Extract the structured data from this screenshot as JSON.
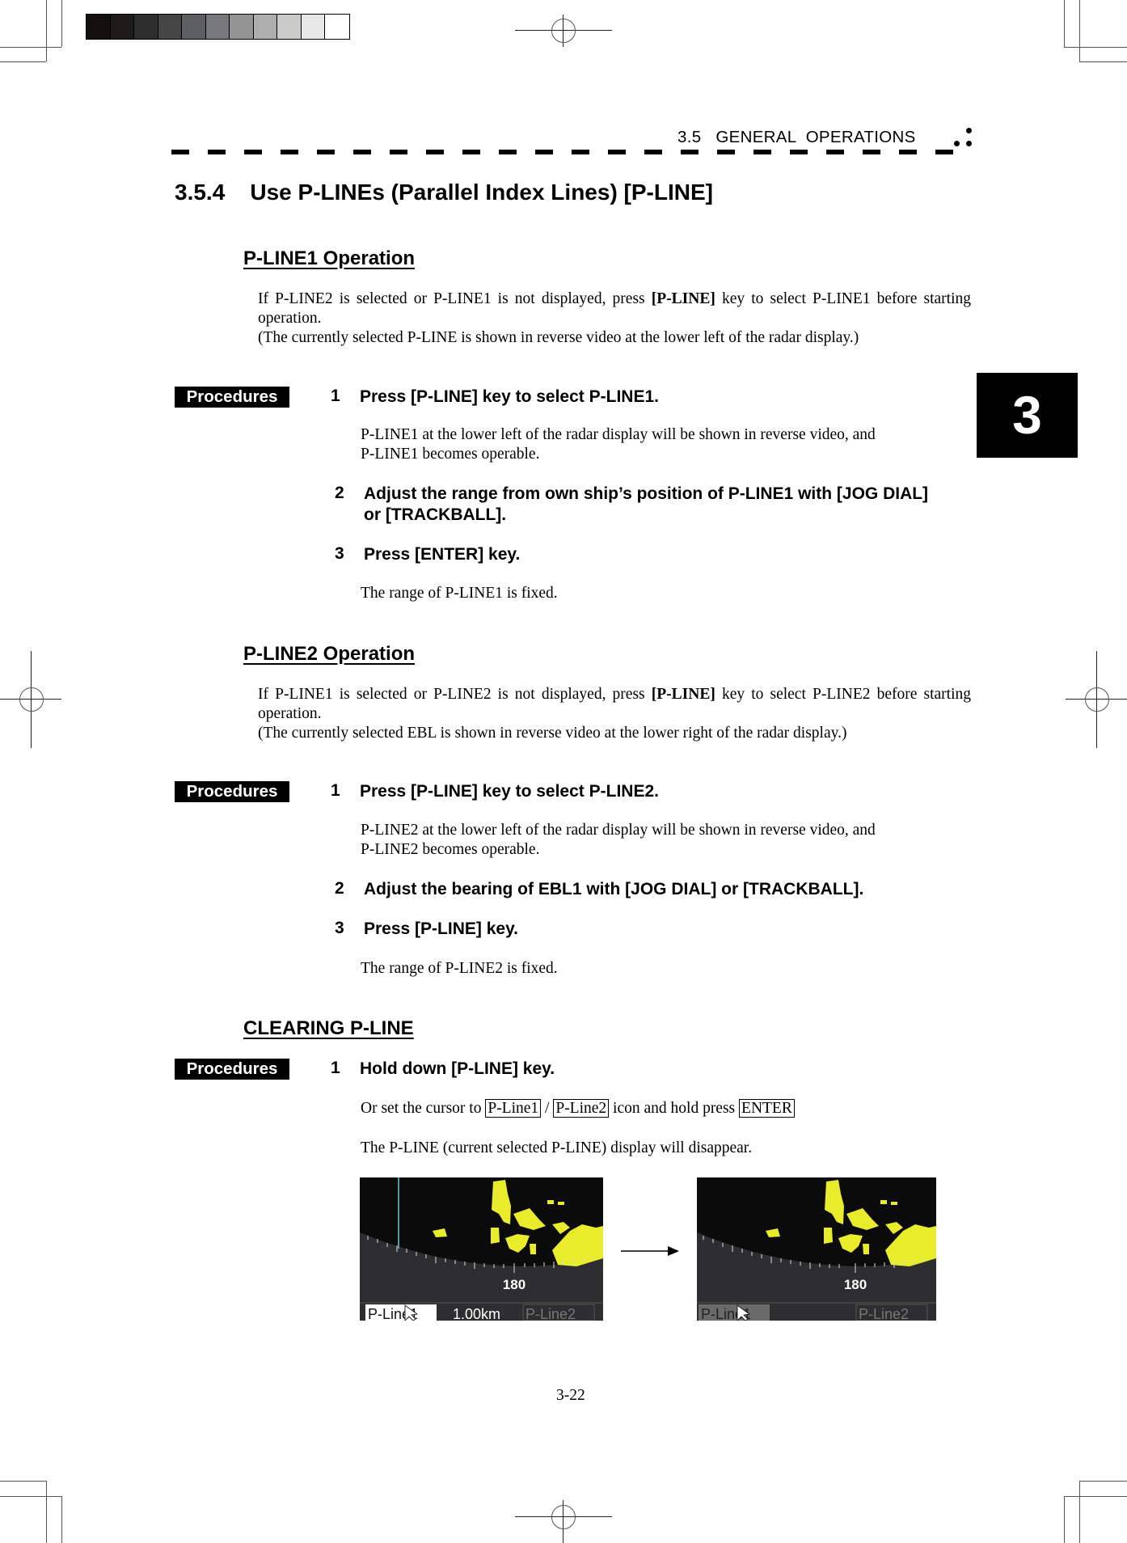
{
  "header": {
    "running_title": "3.5   GENERAL  OPERATIONS",
    "chapter_tab": "3"
  },
  "section": {
    "title": "3.5.4    Use P-LINEs (Parallel Index Lines) [P-LINE]"
  },
  "pline1": {
    "heading": "P-LINE1 Operation",
    "intro_line1_pre": "If P-LINE2 is selected or P-LINE1 is not displayed, press ",
    "intro_key": "[P-LINE]",
    "intro_line1_post": " key to select P-LINE1 before starting operation.",
    "intro_note": "(The currently selected P-LINE is shown in reverse video at the lower left of the radar display.)",
    "procedures_label": "Procedures",
    "steps": [
      {
        "num": "1",
        "text": "Press [P-LINE] key to select P-LINE1.",
        "desc_line1": "P-LINE1 at the lower left of the radar display will be shown in reverse video, and",
        "desc_line2": "P-LINE1 becomes operable."
      },
      {
        "num": "2",
        "text_line1": "Adjust the range from own ship’s position of P-LINE1 with [JOG DIAL]",
        "text_line2": "or [TRACKBALL]."
      },
      {
        "num": "3",
        "text": "Press [ENTER] key.",
        "desc": "The range of P-LINE1 is fixed."
      }
    ]
  },
  "pline2": {
    "heading": "P-LINE2 Operation",
    "intro_line1_pre": "If P-LINE1 is selected or P-LINE2 is not displayed, press ",
    "intro_key": "[P-LINE]",
    "intro_line1_post": " key to select P-LINE2 before starting operation.",
    "intro_note": "(The currently selected EBL is shown in reverse video at the lower right of the radar display.)",
    "procedures_label": "Procedures",
    "steps": [
      {
        "num": "1",
        "text": "Press [P-LINE] key to select P-LINE2.",
        "desc_line1": "P-LINE2 at the lower left of the radar display will be shown in reverse video, and",
        "desc_line2": "P-LINE2 becomes operable."
      },
      {
        "num": "2",
        "text": "Adjust the bearing of EBL1 with [JOG DIAL] or [TRACKBALL]."
      },
      {
        "num": "3",
        "text": "Press [P-LINE] key.",
        "desc": "The range of P-LINE2 is fixed."
      }
    ]
  },
  "clearing": {
    "heading": "CLEARING P-LINE",
    "procedures_label": "Procedures",
    "step_num": "1",
    "step_text": "Hold down [P-LINE] key.",
    "alt_pre": "Or set the cursor to ",
    "alt_key1": "P-Line1",
    "alt_sep": " / ",
    "alt_key2": "P-Line2",
    "alt_mid": " icon and hold press ",
    "alt_key3": "ENTER",
    "result": "The P-LINE (current selected P-LINE) display will disappear."
  },
  "figures": {
    "before": {
      "bearing_label": "180",
      "pline1_label": "P-Line1",
      "range_value": "1.00km",
      "pline2_label": "P-Line2"
    },
    "after": {
      "bearing_label": "180",
      "pline1_label": "P-Line1",
      "range_value": "",
      "pline2_label": "P-Line2"
    },
    "arrow_icon": "right-arrow-icon"
  },
  "footer": {
    "page_number": "3-22"
  },
  "colors": {
    "echo_yellow": "#e8ec2a",
    "radar_bg": "#0b0b0b",
    "panel_gray": "#2e2e30",
    "pline_line": "#6fc6d6"
  }
}
